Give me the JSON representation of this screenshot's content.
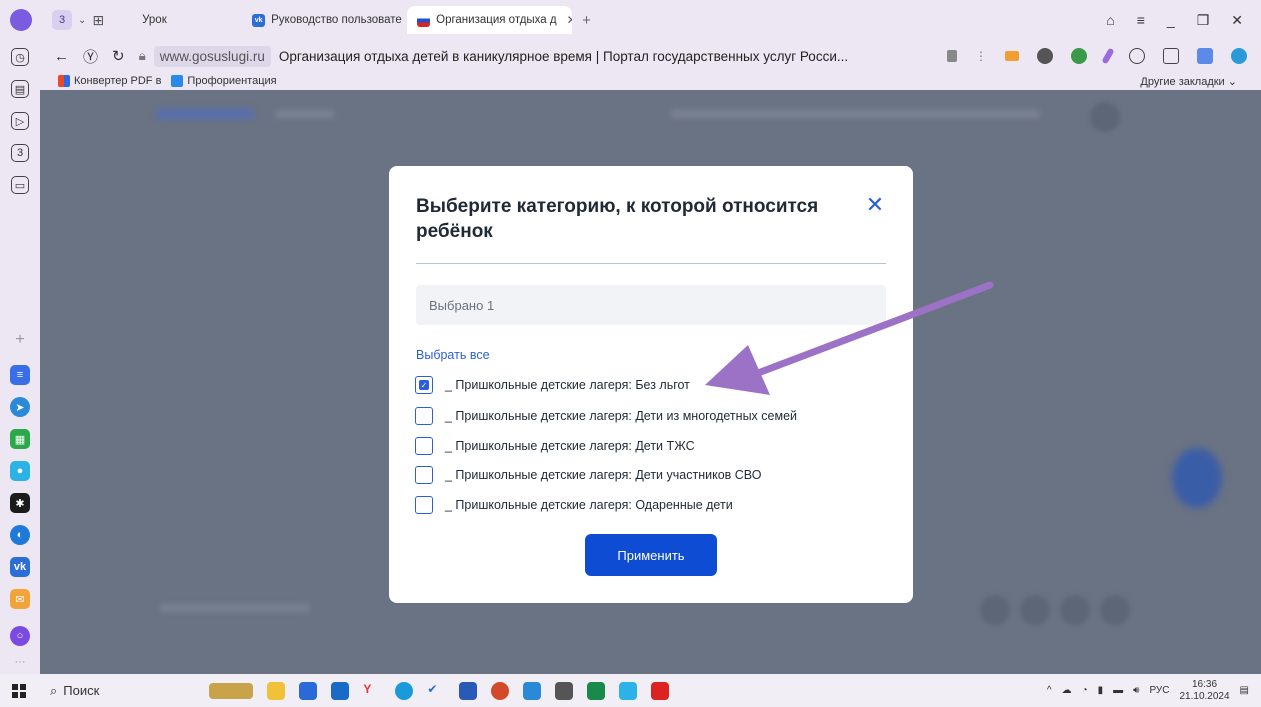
{
  "browser": {
    "tab_count": "3",
    "tabs": [
      {
        "label": "Урок"
      },
      {
        "label": "Руководство пользовате"
      },
      {
        "label": "Организация отдыха д"
      }
    ],
    "address": {
      "domain": "www.gosuslugi.ru",
      "page_title": "Организация отдыха детей в каникулярное время | Портал государственных услуг Росси..."
    },
    "bookmarks": [
      {
        "label": "Конвертер PDF в"
      },
      {
        "label": "Профориентация"
      }
    ],
    "other_bookmarks": "Другие закладки"
  },
  "modal": {
    "title": "Выберите категорию, к которой относится ребёнок",
    "selected_text": "Выбрано 1",
    "select_all": "Выбрать все",
    "options": [
      {
        "label": "_ Пришкольные детские лагеря: Без льгот",
        "checked": true
      },
      {
        "label": "_ Пришкольные детские лагеря: Дети из многодетных семей",
        "checked": false
      },
      {
        "label": "_ Пришкольные детские лагеря: Дети ТЖС",
        "checked": false
      },
      {
        "label": "_ Пришкольные детские лагеря: Дети участников СВО",
        "checked": false
      },
      {
        "label": "_ Пришкольные детские лагеря: Одаренные дети",
        "checked": false
      }
    ],
    "apply_label": "Применить"
  },
  "taskbar": {
    "search_label": "Поиск",
    "lang": "РУС",
    "time": "16:36",
    "date": "21.10.2024"
  },
  "colors": {
    "accent": "#0d4cd3",
    "link": "#2b5fd9",
    "overlay": "#6a7383",
    "annotation": "#9b72c6"
  }
}
